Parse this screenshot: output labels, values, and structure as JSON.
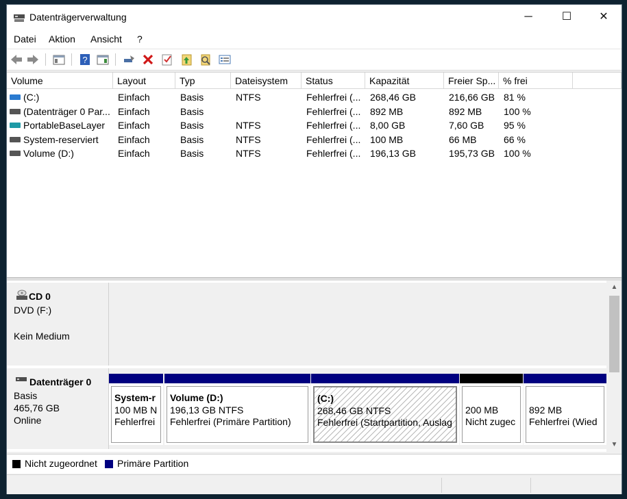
{
  "window": {
    "title": "Datenträgerverwaltung",
    "controls": [
      "─",
      "☐",
      "✕"
    ]
  },
  "menu": [
    "Datei",
    "Aktion",
    "Ansicht",
    "?"
  ],
  "toolbar": [
    "back-icon",
    "forward-icon",
    "console-tree-icon",
    "help-icon",
    "action-pane-icon",
    "connect-disk-icon",
    "delete-icon",
    "checkmark-icon",
    "rescan-icon",
    "properties-icon",
    "list-view-icon"
  ],
  "columns": [
    "Volume",
    "Layout",
    "Typ",
    "Dateisystem",
    "Status",
    "Kapazität",
    "Freier Sp...",
    "% frei"
  ],
  "volumes": [
    {
      "name": "(C:)",
      "layout": "Einfach",
      "type": "Basis",
      "fs": "NTFS",
      "status": "Fehlerfrei (...",
      "capacity": "268,46 GB",
      "free": "216,66 GB",
      "pct": "81 %",
      "icon_color": "#2b7bd0"
    },
    {
      "name": "(Datenträger 0 Par...",
      "layout": "Einfach",
      "type": "Basis",
      "fs": "",
      "status": "Fehlerfrei (...",
      "capacity": "892 MB",
      "free": "892 MB",
      "pct": "100 %",
      "icon_color": "#555555"
    },
    {
      "name": "PortableBaseLayer",
      "layout": "Einfach",
      "type": "Basis",
      "fs": "NTFS",
      "status": "Fehlerfrei (...",
      "capacity": "8,00 GB",
      "free": "7,60 GB",
      "pct": "95 %",
      "icon_color": "#1e9aa6"
    },
    {
      "name": "System-reserviert",
      "layout": "Einfach",
      "type": "Basis",
      "fs": "NTFS",
      "status": "Fehlerfrei (...",
      "capacity": "100 MB",
      "free": "66 MB",
      "pct": "66 %",
      "icon_color": "#555555"
    },
    {
      "name": "Volume (D:)",
      "layout": "Einfach",
      "type": "Basis",
      "fs": "NTFS",
      "status": "Fehlerfrei (...",
      "capacity": "196,13 GB",
      "free": "195,73 GB",
      "pct": "100 %",
      "icon_color": "#555555"
    }
  ],
  "cd": {
    "name": "CD 0",
    "line1": "DVD (F:)",
    "line2": "Kein Medium"
  },
  "disk0": {
    "name": "Datenträger 0",
    "type": "Basis",
    "size": "465,76 GB",
    "state": "Online",
    "partitions": [
      {
        "title": "System-r",
        "line1": "100 MB N",
        "line2": "Fehlerfrei",
        "bar": "#000080",
        "hatched": false
      },
      {
        "title": "Volume  (D:)",
        "line1": "196,13 GB NTFS",
        "line2": "Fehlerfrei (Primäre Partition)",
        "bar": "#000080",
        "hatched": false
      },
      {
        "title": "(C:)",
        "line1": "268,46 GB NTFS",
        "line2": "Fehlerfrei (Startpartition, Auslag",
        "bar": "#000080",
        "hatched": true
      },
      {
        "title": "",
        "line1": "200 MB",
        "line2": "Nicht zugec",
        "bar": "#000000",
        "hatched": false
      },
      {
        "title": "",
        "line1": "892 MB",
        "line2": "Fehlerfrei (Wied",
        "bar": "#000080",
        "hatched": false
      }
    ]
  },
  "legend": [
    {
      "label": "Nicht zugeordnet",
      "color": "#000000"
    },
    {
      "label": "Primäre Partition",
      "color": "#000080"
    }
  ]
}
